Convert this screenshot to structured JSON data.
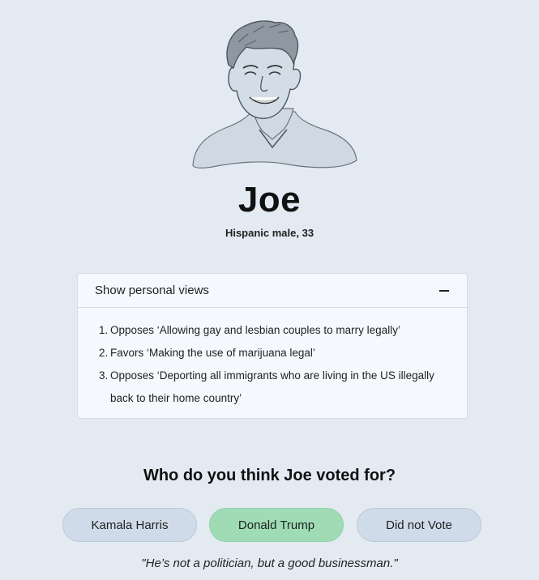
{
  "profile": {
    "name": "Joe",
    "description": "Hispanic male, 33",
    "portrait_icon": "man-portrait-sketch"
  },
  "views_panel": {
    "title": "Show personal views",
    "toggle_icon": "minus-icon",
    "items": [
      {
        "num": "1.",
        "text": "Opposes ‘Allowing gay and lesbian couples to marry legally’"
      },
      {
        "num": "2.",
        "text": "Favors ‘Making the use of marijuana legal’"
      },
      {
        "num": "3.",
        "text": "Opposes ‘Deporting all immigrants who are living in the US illegally back to their home country’"
      }
    ]
  },
  "question": "Who do you think Joe voted for?",
  "choices": [
    {
      "label": "Kamala Harris",
      "selected": false
    },
    {
      "label": "Donald Trump",
      "selected": true
    },
    {
      "label": "Did not Vote",
      "selected": false
    }
  ],
  "quote": "\"He’s not a politician, but a good businessman.\"",
  "colors": {
    "background": "#e3eaf2",
    "panel": "#f5f9fd",
    "choice_default": "#cfdbe8",
    "choice_selected": "#9fdcb6"
  }
}
